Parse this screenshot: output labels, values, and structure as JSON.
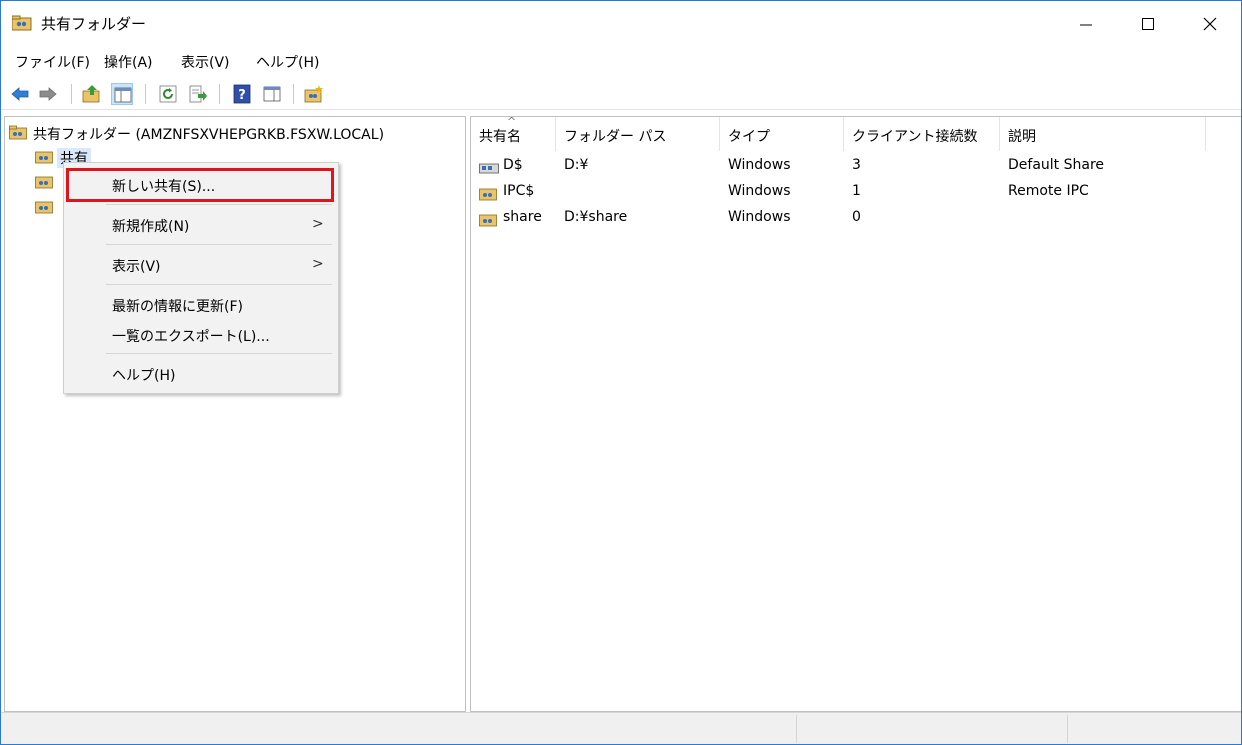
{
  "window": {
    "title": "共有フォルダー",
    "controls": {
      "minimize": "minimize-icon",
      "maximize": "maximize-icon",
      "close": "close-icon"
    }
  },
  "menubar": [
    {
      "label": "ファイル(F)"
    },
    {
      "label": "操作(A)"
    },
    {
      "label": "表示(V)"
    },
    {
      "label": "ヘルプ(H)"
    }
  ],
  "toolbar": [
    "back-arrow-icon",
    "forward-arrow-icon",
    "up-folder-icon",
    "show-hide-tree-icon",
    "refresh-icon",
    "export-list-icon",
    "help-icon",
    "properties-pane-icon",
    "new-share-icon"
  ],
  "tree": {
    "root": "共有フォルダー (AMZNFSXVHEPGRKB.FSXW.LOCAL)",
    "items": [
      {
        "label": "共有",
        "selected": true
      },
      {
        "label": ""
      },
      {
        "label": ""
      }
    ]
  },
  "context_menu": {
    "items": [
      {
        "label": "新しい共有(S)...",
        "submenu": false,
        "highlighted": true
      },
      {
        "label": "新規作成(N)",
        "submenu": true
      },
      {
        "label": "表示(V)",
        "submenu": true
      },
      {
        "label": "最新の情報に更新(F)",
        "submenu": false
      },
      {
        "label": "一覧のエクスポート(L)...",
        "submenu": false
      },
      {
        "label": "ヘルプ(H)",
        "submenu": false
      }
    ],
    "submenu_arrow": ">"
  },
  "list": {
    "columns": [
      "共有名",
      "フォルダー パス",
      "タイプ",
      "クライアント接続数",
      "説明"
    ],
    "sort_indicator": "^",
    "rows": [
      {
        "name": "D$",
        "path": "D:¥",
        "type": "Windows",
        "clients": "3",
        "description": "Default Share",
        "icon": "admin-share-icon"
      },
      {
        "name": "IPC$",
        "path": "",
        "type": "Windows",
        "clients": "1",
        "description": "Remote IPC",
        "icon": "share-folder-icon"
      },
      {
        "name": "share",
        "path": "D:¥share",
        "type": "Windows",
        "clients": "0",
        "description": "",
        "icon": "share-folder-icon"
      }
    ]
  },
  "colors": {
    "accent": "#2b79d4",
    "highlight_border": "#e0141c",
    "selection": "#d9e8fb"
  }
}
